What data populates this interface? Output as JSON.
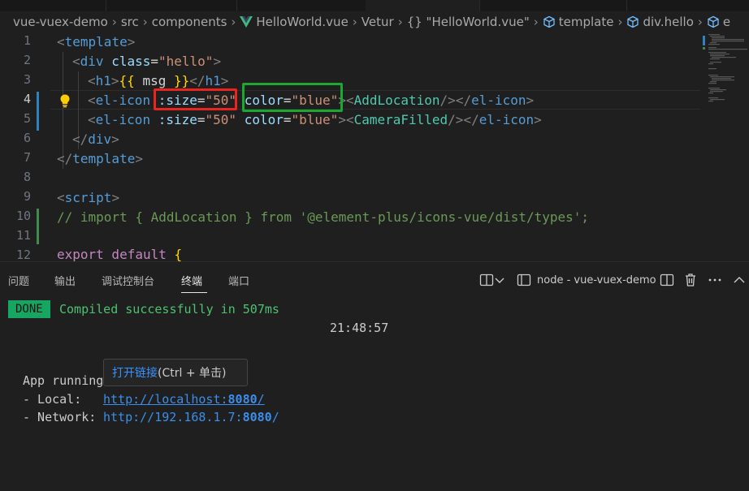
{
  "breadcrumb": {
    "items": [
      "vue-vuex-demo",
      "src",
      "components",
      "HelloWorld.vue",
      "Vetur",
      "{} \"HelloWorld.vue\"",
      "template",
      "div.hello",
      "e"
    ]
  },
  "gutter": [
    "1",
    "2",
    "3",
    "4",
    "5",
    "6",
    "7",
    "8",
    "9",
    "10",
    "11",
    "12"
  ],
  "code": {
    "l1": {
      "open": "<",
      "tag": "template",
      "close": ">"
    },
    "l2": {
      "open": "<",
      "tag": "div",
      "attr": "class",
      "eq": "=",
      "val": "\"hello\"",
      "close": ">"
    },
    "l3": {
      "open": "<",
      "tag": "h1",
      "close": ">",
      "b1": "{{",
      "expr": " msg ",
      "b2": "}}",
      "open2": "</",
      "tag2": "h1",
      "close2": ">"
    },
    "l4": {
      "open": "<",
      "tag": "el-icon",
      "sp": " ",
      "attr1": ":size",
      "eq": "=",
      "val1": "\"50\"",
      "sp2": " ",
      "attr2": "color",
      "val2": "\"blue\"",
      "open2": "><",
      "comp": "AddLocation",
      "close2": "/></",
      "tag2": "el-icon",
      "close3": ">"
    },
    "l5": {
      "open": "<",
      "tag": "el-icon",
      "sp": " ",
      "attr1": ":size",
      "eq": "=",
      "val1": "\"50\"",
      "sp2": " ",
      "attr2": "color",
      "val2": "\"blue\"",
      "open2": "><",
      "comp": "CameraFilled",
      "close2": "/></",
      "tag2": "el-icon",
      "close3": ">"
    },
    "l6": {
      "open": "</",
      "tag": "div",
      "close": ">"
    },
    "l7": {
      "open": "</",
      "tag": "template",
      "close": ">"
    },
    "l9": {
      "open": "<",
      "tag": "script",
      "close": ">"
    },
    "l10": {
      "comment": "// import { AddLocation } from '@element-plus/icons-vue/dist/types';"
    },
    "l12": {
      "kw": "export default",
      "sp": " ",
      "brace": "{"
    }
  },
  "panel": {
    "tabs": [
      "问题",
      "输出",
      "调试控制台",
      "终端",
      "端口"
    ],
    "active_tab": "终端",
    "terminal_name": "node - vue-vuex-demo"
  },
  "terminal": {
    "badge": "DONE",
    "compiled": "Compiled successfully in 507ms",
    "time": "21:48:57",
    "app_running": "App running",
    "local_label": "- Local:   ",
    "local_url_pre": "http://localhost:",
    "local_url_port": "8080",
    "local_url_post": "/",
    "network_label": "- Network: ",
    "network_url_pre": "http://192.168.1.7:",
    "network_url_port": "8080",
    "network_url_post": "/"
  },
  "tooltip": {
    "link": "打开链接",
    "hint": " (Ctrl + 单击)"
  },
  "colors": {
    "highlight_red": "#e8251e",
    "highlight_green": "#1aa830",
    "done_badge": "#16a662"
  }
}
